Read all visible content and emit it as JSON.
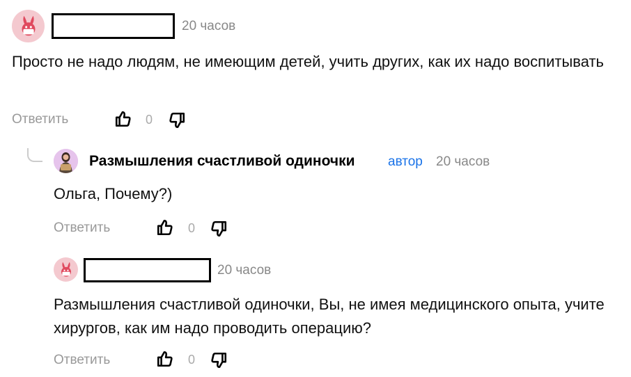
{
  "comments": [
    {
      "time": "20 часов",
      "text": "Просто не надо людям, не имеющим детей, учить других, как их надо воспитывать",
      "reply_label": "Ответить",
      "like_count": "0"
    },
    {
      "author": "Размышления счастливой одиночки",
      "badge": "автор",
      "time": "20 часов",
      "text": "Ольга, Почему?)",
      "reply_label": "Ответить",
      "like_count": "0"
    },
    {
      "time": "20 часов",
      "text": "Размышления счастливой одиночки, Вы, не имея медицинского опыта, учите хирургов, как им надо проводить операцию?",
      "reply_label": "Ответить",
      "like_count": "0"
    }
  ],
  "icons": {
    "avatar_default": "rabbit-avatar-icon",
    "like": "thumbs-up-icon",
    "dislike": "thumbs-down-icon"
  },
  "colors": {
    "badge": "#1a73e8",
    "muted": "#888888",
    "avatar_bg": "#f4c9cf",
    "avatar_icon": "#e0495e"
  }
}
